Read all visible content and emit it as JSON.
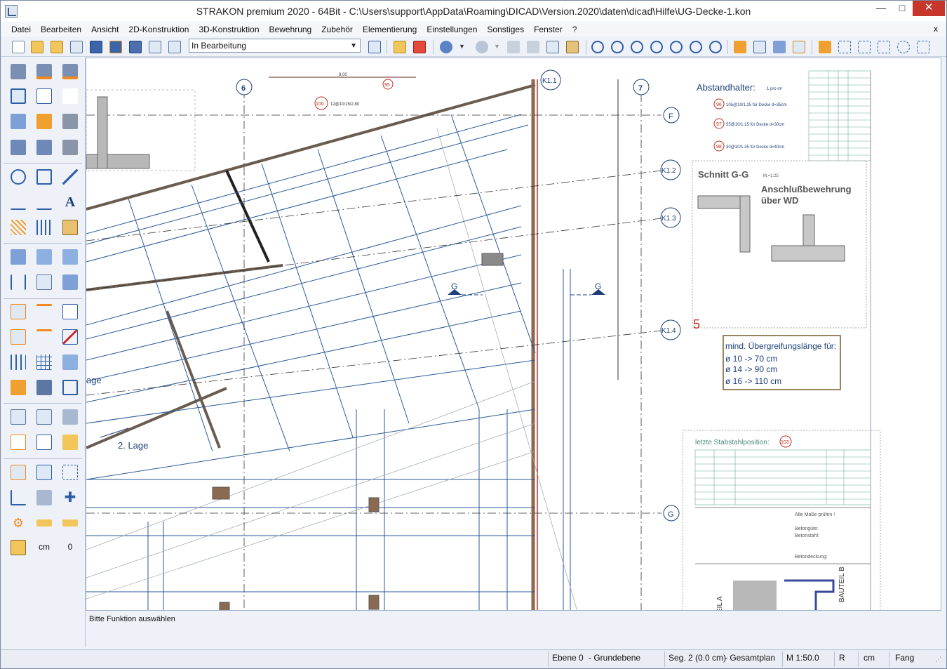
{
  "window": {
    "title": "STRAKON premium 2020 - 64Bit - C:\\Users\\support\\AppData\\Roaming\\DICAD\\Version.2020\\daten\\dicad\\Hilfe\\UG-Decke-1.kon"
  },
  "menu": [
    {
      "label": "Datei"
    },
    {
      "label": "Bearbeiten"
    },
    {
      "label": "Ansicht"
    },
    {
      "label": "2D-Konstruktion"
    },
    {
      "label": "3D-Konstruktion"
    },
    {
      "label": "Bewehrung"
    },
    {
      "label": "Zubehör"
    },
    {
      "label": "Elementierung"
    },
    {
      "label": "Einstellungen"
    },
    {
      "label": "Sonstiges"
    },
    {
      "label": "Fenster"
    },
    {
      "label": "?"
    }
  ],
  "menu_close": "x",
  "toolbar": {
    "combo_value": "In Bearbeitung"
  },
  "left_panel": {
    "unit_label": "cm",
    "zero_label": "0"
  },
  "drawing": {
    "axes": {
      "a6": "6",
      "a7": "7",
      "F": "F",
      "G": "G",
      "K11": "K1.1",
      "K12": "K1.2",
      "K13": "K1.3",
      "K14": "K1.4"
    },
    "spacers_title": "Abstandhalter:",
    "spacers_sub": "1 pro m²",
    "spacers": [
      {
        "pos": "96",
        "text": "105@10/1.25 für Decke d=35cm"
      },
      {
        "pos": "97",
        "text": "55@10/1.15 für Decke d=30cm"
      },
      {
        "pos": "98",
        "text": "30@10/1.35 für Decke d=40cm"
      }
    ],
    "section_title": "Schnitt G-G",
    "section_scale": "M.=1:25",
    "connection_title_1": "Anschlußbewehrung",
    "connection_title_2": "über WD",
    "section_number": "5",
    "overlap_title": "mind. Übergreifungslänge für:",
    "overlap_rows": [
      "ø 10 -> 70 cm",
      "ø 14 -> 90 cm",
      "ø 16 -> 110 cm"
    ],
    "last_position_label": "letzte Stabstahlposition:",
    "last_position_value": "103",
    "layer_label": "2. Lage",
    "layer_label_cut": "age",
    "section_marker": "G",
    "dimension_top": "8,00",
    "pos95_label": "95",
    "pos100_label": "100",
    "bar100_text": "12@10/15/2,80",
    "bauteil_b": "BAUTEIL B",
    "bauteil_a": "EIL A",
    "titleblock_note": "Alle Maße prüfen !",
    "titleblock_concrete": "Betongüte:",
    "titleblock_steel": "Betonstahl:",
    "titleblock_cover": "Betondeckung:"
  },
  "status": {
    "prompt": "Bitte Funktion auswählen",
    "layer": "Ebene 0",
    "layer_name": "- Grundebene",
    "segment": "Seg. 2 (0.0 cm)",
    "plan": "- Gesamtplan",
    "scale": "M 1:50.0",
    "r": "R",
    "unit": "cm",
    "snap": "Fang"
  }
}
